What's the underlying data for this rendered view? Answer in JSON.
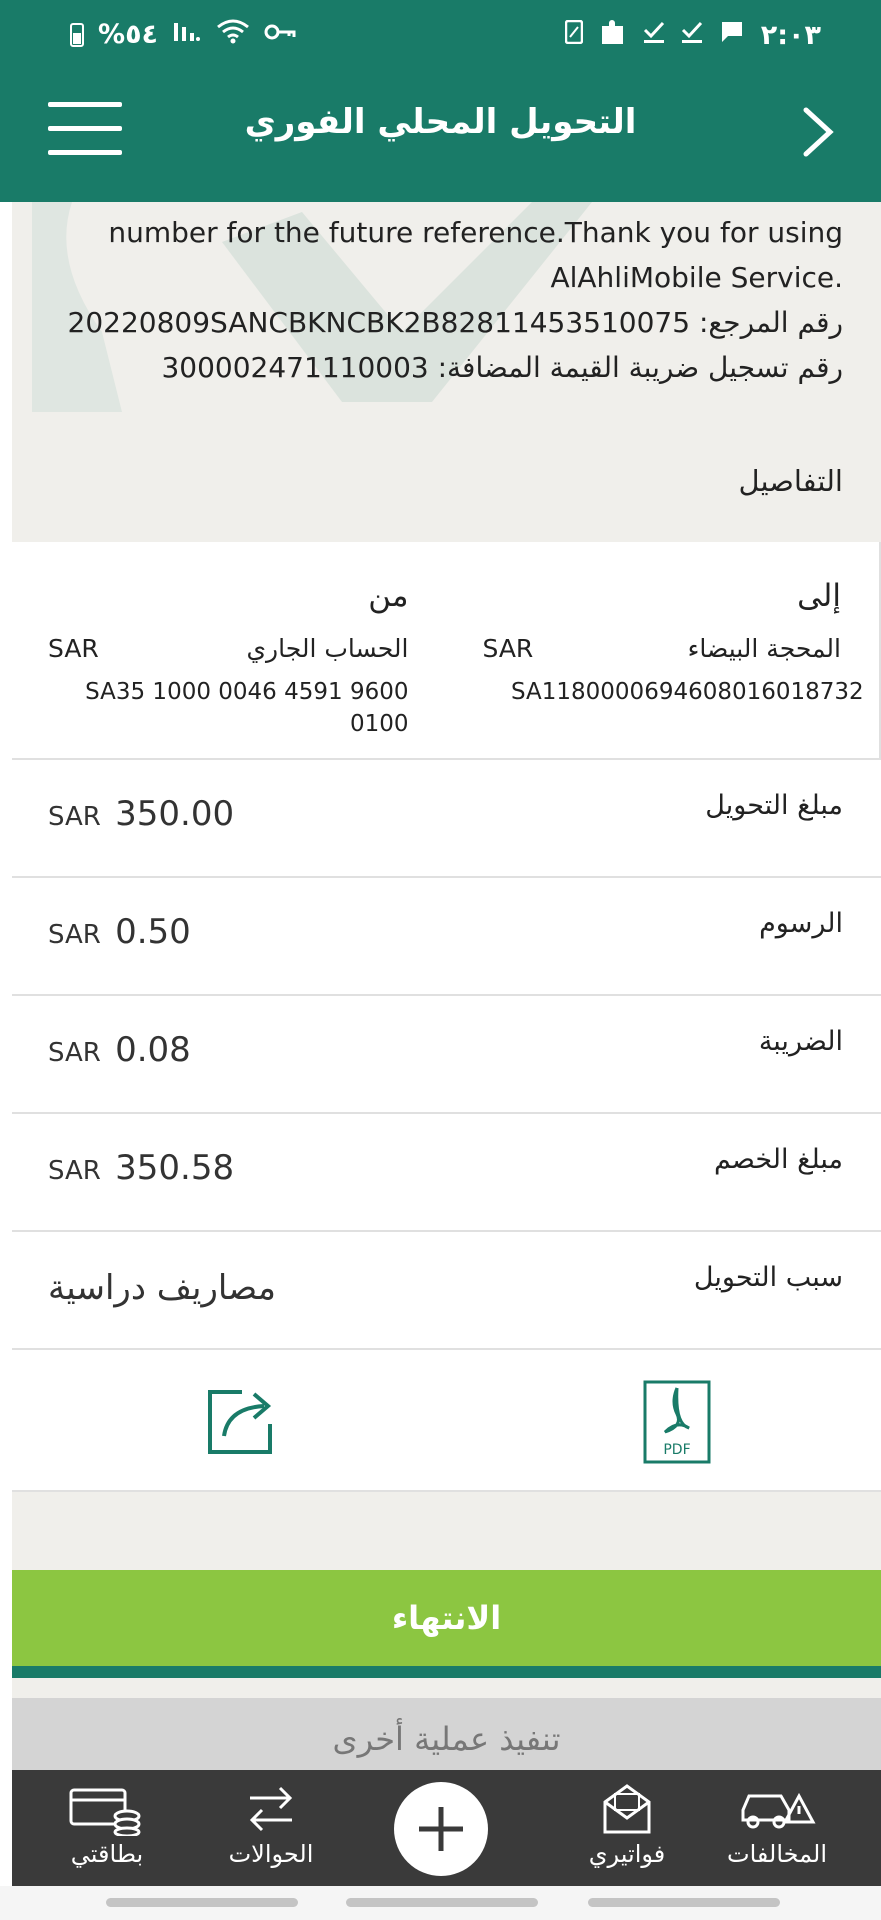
{
  "status_bar": {
    "battery": "%٥٤",
    "time": "٢:٠٣"
  },
  "header": {
    "title": "التحويل المحلي الفوري",
    "menu_icon": "hamburger-menu-icon",
    "back_icon": "chevron-right-icon"
  },
  "receipt": {
    "line1": "number for the future reference.Thank you for using",
    "line2": ".AlAhliMobile Service",
    "reference_label": "رقم المرجع:",
    "reference_value": "20220809SANCBKNCBK2B82811453510075",
    "vat_label": "رقم تسجيل ضريبة القيمة المضافة:",
    "vat_value": "300002471110003"
  },
  "details": {
    "title": "التفاصيل",
    "from": {
      "heading": "من",
      "account_name": "الحساب الجاري",
      "currency": "SAR",
      "iban": "SA35 1000 0046 4591 9600 0100"
    },
    "to": {
      "heading": "إلى",
      "account_name": "المحجة البيضاء",
      "currency": "SAR",
      "iban": "SA1180000694608016018732"
    },
    "rows": [
      {
        "label": "مبلغ التحويل",
        "currency": "SAR",
        "amount": "350.00"
      },
      {
        "label": "الرسوم",
        "currency": "SAR",
        "amount": "0.50"
      },
      {
        "label": "الضريبة",
        "currency": "SAR",
        "amount": "0.08"
      },
      {
        "label": "مبلغ الخصم",
        "currency": "SAR",
        "amount": "350.58"
      }
    ],
    "reason": {
      "label": "سبب التحويل",
      "value": "مصاريف دراسية"
    },
    "pdf_label": "PDF"
  },
  "buttons": {
    "finish": "الانتهاء",
    "another": "تنفيذ عملية أخرى"
  },
  "bottom_nav": {
    "violations": "المخالفات",
    "bills": "فواتيري",
    "transfers": "الحوالات",
    "cards": "بطاقتي"
  },
  "colors": {
    "header": "#197b68",
    "finish_button": "#8cc641",
    "bottom_nav": "#3a3a3a",
    "content_bg": "#f0efeb"
  }
}
